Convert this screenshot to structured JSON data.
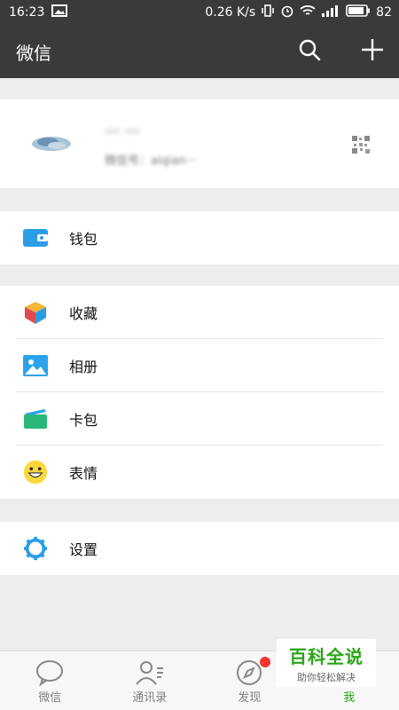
{
  "status_bar": {
    "time": "16:23",
    "speed": "0.26 K/s",
    "battery": "82"
  },
  "app_bar": {
    "title": "微信",
    "search_icon": "search-icon",
    "add_icon": "plus-icon"
  },
  "profile": {
    "name": "··· ···",
    "wechat_id": "微信号：aiqian···"
  },
  "menu": {
    "wallet": "钱包",
    "favorites": "收藏",
    "album": "相册",
    "cards": "卡包",
    "stickers": "表情",
    "settings": "设置"
  },
  "bottom_nav": {
    "chats": "微信",
    "contacts": "通讯录",
    "discover": "发现",
    "me": "我"
  },
  "watermark": {
    "title": "百科全说",
    "subtitle": "助你轻松解决"
  },
  "colors": {
    "header": "#3a3a3a",
    "accent_green": "#2aa515",
    "wallet_blue": "#2b9de6",
    "badge_red": "#f43530"
  }
}
